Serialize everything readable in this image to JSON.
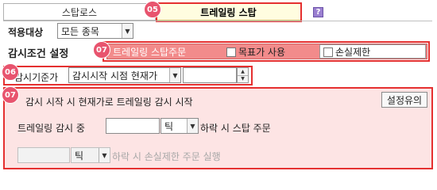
{
  "tabs": [
    {
      "label": "스탑로스"
    },
    {
      "label": "트레일링 스탑"
    }
  ],
  "help_icon": "?",
  "badges": {
    "tab": "05",
    "condition": "07",
    "standard": "06",
    "main": "07"
  },
  "apply_target": {
    "label": "적용대상",
    "value": "모든 종목"
  },
  "condition": {
    "label": "감시조건 설정",
    "trailing_order_label": "트레일링 스탑주문",
    "target_price_label": "목표가 사용",
    "stop_loss_label": "손실제한"
  },
  "standard_price": {
    "label": "감시기준가",
    "value": "감시시작 시점 현재가",
    "input_value": ""
  },
  "main": {
    "start_text": "감시 시작 시 현재가로 트레일링 감시 시작",
    "caution_button": "설정유의",
    "trailing_label": "트레일링 감시 중",
    "trailing_value": "",
    "trailing_unit": "틱",
    "trailing_suffix": "하락 시 스탑 주문",
    "loss_value": "",
    "loss_unit": "틱",
    "loss_suffix": "하락 시 손실제한 주문 실행"
  },
  "colors": {
    "active_tab_bg": "#fffde0",
    "highlight_red": "#e53030",
    "badge_pink": "#e8546e",
    "condition_bg": "#f28b8b",
    "panel_bg": "#fde4e4"
  }
}
